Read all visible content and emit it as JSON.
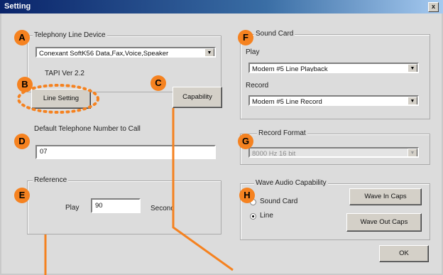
{
  "window": {
    "title": "Setting",
    "close_label": "x"
  },
  "telephony": {
    "group_label": "Telephony Line Device",
    "device_value": "Conexant SoftK56 Data,Fax,Voice,Speaker",
    "tapi_version": "TAPI Ver 2.2",
    "line_setting_label": "Line Setting",
    "capability_label": "Capability"
  },
  "default_number": {
    "label": "Default Telephone Number to Call",
    "value": "07"
  },
  "reference": {
    "group_label": "Reference",
    "play_label": "Play",
    "play_value": "90",
    "unit_label": "Second"
  },
  "sound_card": {
    "group_label": "Sound Card",
    "play_label": "Play",
    "play_value": "Modem #5 Line Playback",
    "record_label": "Record",
    "record_value": "Modem #5 Line Record"
  },
  "record_format": {
    "group_label": "Record Format",
    "value": "8000 Hz 16 bit"
  },
  "wave_audio": {
    "group_label": "Wave Audio Capability",
    "option_sound_card": "Sound Card",
    "option_line": "Line",
    "selected": "Line",
    "wave_in_caps_label": "Wave In Caps",
    "wave_out_caps_label": "Wave Out Caps"
  },
  "ok_label": "OK",
  "badges": {
    "a": "A",
    "b": "B",
    "c": "C",
    "d": "D",
    "e": "E",
    "f": "F",
    "g": "G",
    "h": "H"
  },
  "colors": {
    "accent": "#f58220",
    "title_bar": "#0a246a"
  }
}
